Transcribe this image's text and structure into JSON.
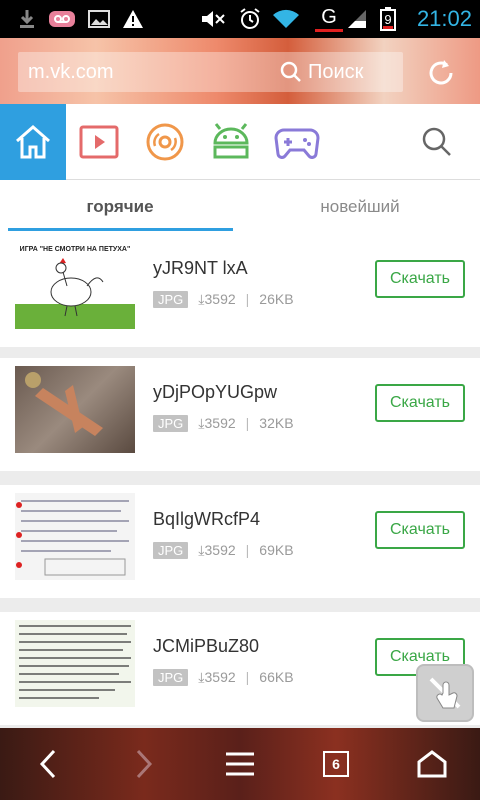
{
  "status_bar": {
    "time": "21:02",
    "battery_level": "9",
    "network": "G",
    "icons": [
      "download-icon",
      "voicemail-icon",
      "image-icon",
      "warning-icon",
      "mute-icon",
      "alarm-icon",
      "wifi-icon",
      "network-g-icon",
      "signal-icon",
      "battery-icon"
    ]
  },
  "header": {
    "url": "m.vk.com",
    "search_label": "Поиск"
  },
  "tabs": [
    {
      "icon": "home-icon",
      "active": true
    },
    {
      "icon": "video-icon"
    },
    {
      "icon": "music-disc-icon"
    },
    {
      "icon": "android-icon"
    },
    {
      "icon": "gamepad-icon"
    },
    {
      "icon": "search-icon"
    }
  ],
  "subtabs": {
    "hot": "горячие",
    "newest": "новейший"
  },
  "items": [
    {
      "name": "yJR9NT lxA",
      "type": "JPG",
      "downloads": "3592",
      "size": "26KB",
      "button": "Скачать",
      "thumb_caption": "ИГРА \"НЕ СМОТРИ НА ПЕТУХА\""
    },
    {
      "name": "yDjPOpYUGpw",
      "type": "JPG",
      "downloads": "3592",
      "size": "32KB",
      "button": "Скачать"
    },
    {
      "name": "BqIlgWRcfP4",
      "type": "JPG",
      "downloads": "3592",
      "size": "69KB",
      "button": "Скачать"
    },
    {
      "name": "JCMiPBuZ80",
      "type": "JPG",
      "downloads": "3592",
      "size": "66KB",
      "button": "Скачать"
    }
  ],
  "bottom_nav": {
    "tab_count": "6"
  },
  "colors": {
    "accent_blue": "#2f9fe0",
    "accent_green": "#3aa746",
    "clock_blue": "#33b5e5"
  }
}
